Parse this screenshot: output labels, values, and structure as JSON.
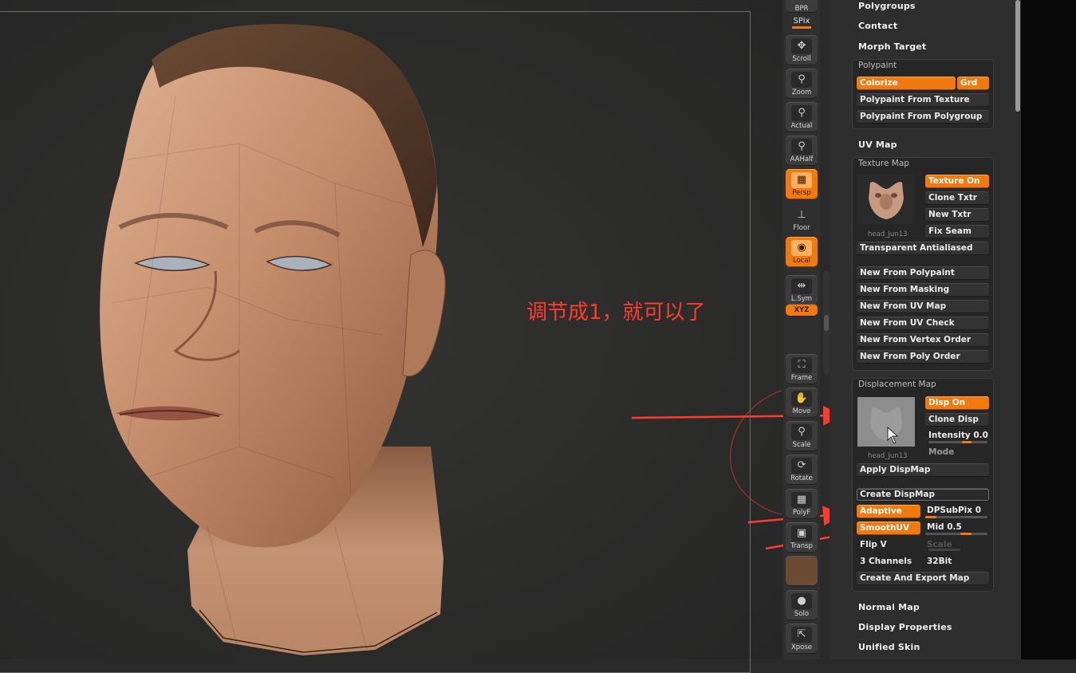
{
  "annotation": "调节成1，就可以了",
  "colors": {
    "accent": "#f07a10",
    "annotation_red": "#ff3b30"
  },
  "shelf": {
    "spix_label": "SPix",
    "bpr_label": "BPR",
    "buttons": [
      {
        "name": "scroll",
        "label": "Scroll",
        "icon": "✥"
      },
      {
        "name": "zoom",
        "label": "Zoom",
        "icon": "⚲"
      },
      {
        "name": "actual",
        "label": "Actual",
        "icon": "⚲"
      },
      {
        "name": "aahalf",
        "label": "AAHalf",
        "icon": "⚲"
      },
      {
        "name": "persp",
        "label": "Persp",
        "icon": "▦"
      },
      {
        "name": "floor",
        "label": "Floor",
        "icon": "⊥"
      },
      {
        "name": "local",
        "label": "Local",
        "icon": "◉"
      },
      {
        "name": "lsym",
        "label": "L.Sym",
        "icon": "⇹"
      },
      {
        "name": "xyz",
        "label": "XYZ",
        "icon": ""
      },
      {
        "name": "frame",
        "label": "Frame",
        "icon": "⛶"
      },
      {
        "name": "move",
        "label": "Move",
        "icon": "✋"
      },
      {
        "name": "scale",
        "label": "Scale",
        "icon": "⚲"
      },
      {
        "name": "rotate",
        "label": "Rotate",
        "icon": "⟳"
      },
      {
        "name": "polyf",
        "label": "PolyF",
        "icon": "▦"
      },
      {
        "name": "transp",
        "label": "Transp",
        "icon": "▣"
      },
      {
        "name": "solo",
        "label": "Solo",
        "icon": "●"
      },
      {
        "name": "xpose",
        "label": "Xpose",
        "icon": "⇱"
      }
    ]
  },
  "panel": {
    "polygroups": "Polygroups",
    "contact": "Contact",
    "morph_target": "Morph Target",
    "polypaint": {
      "title": "Polypaint",
      "colorize": "Colorize",
      "grd": "Grd",
      "from_texture": "Polypaint From Texture",
      "from_polygroup": "Polypaint From Polygroup"
    },
    "uv_map": "UV Map",
    "texture_map": {
      "title": "Texture Map",
      "texture_on": "Texture On",
      "clone_txtr": "Clone Txtr",
      "new_txtr": "New Txtr",
      "fix_seam": "Fix Seam",
      "thumb_caption": "head_Jun13",
      "transparent_antialiased": "Transparent Antialiased",
      "new_from": [
        "New From Polypaint",
        "New From Masking",
        "New From UV Map",
        "New From UV Check",
        "New From Vertex Order",
        "New From Poly Order"
      ]
    },
    "displacement_map": {
      "title": "Displacement Map",
      "disp_on": "Disp On",
      "clone_disp": "Clone Disp",
      "intensity_label": "Intensity",
      "intensity_value": "0.0",
      "mode": "Mode",
      "thumb_caption": "head_Jun13",
      "apply_dispmap": "Apply DispMap",
      "create_dispmap": "Create DispMap",
      "adaptive": "Adaptive",
      "dpsubpix_label": "DPSubPix",
      "dpsubpix_value": "0",
      "smoothuv": "SmoothUV",
      "mid_label": "Mid",
      "mid_value": "0.5",
      "flip_v": "Flip V",
      "scale": "Scale",
      "channels": "3 Channels",
      "bit": "32Bit",
      "create_export": "Create And Export Map"
    },
    "normal_map": "Normal Map",
    "display_properties": "Display Properties",
    "unified_skin": "Unified Skin"
  }
}
